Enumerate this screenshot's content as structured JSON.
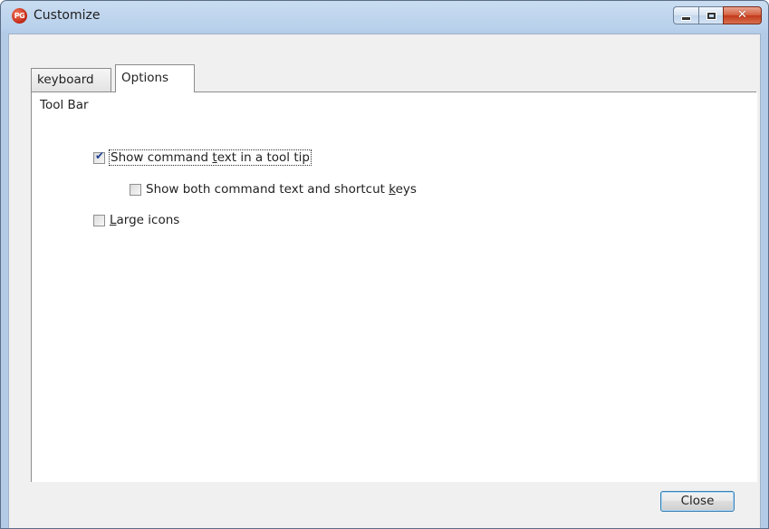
{
  "window": {
    "title": "Customize",
    "app_icon_text": "PG",
    "close_glyph": "✕"
  },
  "tabs": [
    {
      "label": "keyboard",
      "selected": false
    },
    {
      "label": "Options",
      "selected": true
    }
  ],
  "options_panel": {
    "group_label": "Tool Bar",
    "items": [
      {
        "label_before": "Show command ",
        "mnemonic": "t",
        "label_after": "ext in a tool tip",
        "checked": true,
        "focused": true
      },
      {
        "label_before": "Show both command text and shortcut ",
        "mnemonic": "k",
        "label_after": "eys",
        "checked": false,
        "focused": false
      },
      {
        "label_before": "",
        "mnemonic": "L",
        "label_after": "arge icons",
        "checked": false,
        "focused": false
      }
    ]
  },
  "footer": {
    "close_label": "Close"
  },
  "colors": {
    "title_bar": "#b9d1ec",
    "client_bg": "#f0f0f0",
    "close_caption": "#c2391b",
    "button_border": "#3c7fb1"
  },
  "icons": {
    "minimize": "minimize-icon",
    "maximize": "maximize-icon",
    "close": "close-icon",
    "app": "app-logo-icon",
    "checkmark": "checkmark-icon"
  }
}
